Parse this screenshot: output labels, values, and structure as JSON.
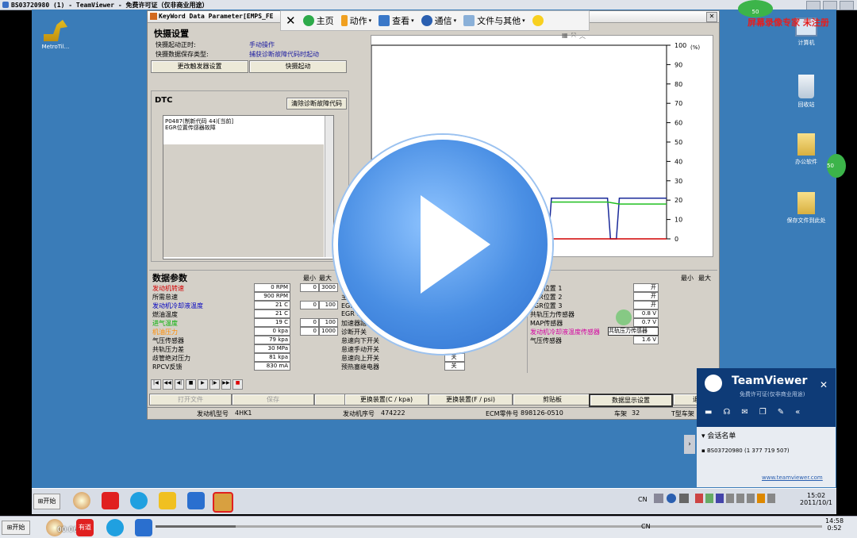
{
  "outer_window": {
    "title": "BS03720980 (1) - TeamViewer - 免费许可证（仅非商业用途）"
  },
  "desktop": {
    "icons": [
      {
        "label": "MetroTil..."
      },
      {
        "label": "计算机"
      },
      {
        "label": "回收站"
      },
      {
        "label": "办公软件"
      },
      {
        "label": "保存文件到此处"
      }
    ],
    "notice": "屏幕录像专家 未注册",
    "bubble1": "50",
    "bubble2": "50"
  },
  "teamviewer_toolbar": {
    "items": [
      "主页",
      "动作",
      "查看",
      "通信",
      "文件与其他"
    ]
  },
  "app": {
    "title": "KeyWord Data Parameter[EMPS_FE",
    "snapshot": {
      "title": "快摄设置",
      "start_label": "快摄起动正时:",
      "start_value": "手动操作",
      "save_label": "快摄数据保存类型:",
      "save_value": "捕获诊断故障代码时起动",
      "btn_trigger": "更改触发器设置",
      "btn_start": "快摄起动"
    },
    "dtc": {
      "title": "DTC",
      "btn_clear": "清除诊断故障代码",
      "line1": "P0487(制新代码 44)[当前]",
      "line2": "EGR位置传感器故障"
    },
    "data_params": {
      "title": "数据参数",
      "min_label": "最小",
      "max_label": "最大",
      "rows": [
        {
          "name": "发动机转速",
          "value": "0 RPM",
          "min": "0",
          "max": "3000",
          "color": "#d40000"
        },
        {
          "name": "所需怠速",
          "value": "900 RPM",
          "min": "",
          "max": "",
          "color": "#000000"
        },
        {
          "name": "发动机冷却液温度",
          "value": "21 C",
          "min": "0",
          "max": "100",
          "color": "#0000c0"
        },
        {
          "name": "燃油温度",
          "value": "21 C",
          "min": "",
          "max": "",
          "color": "#000000"
        },
        {
          "name": "进气温度",
          "value": "19 C",
          "min": "0",
          "max": "100",
          "color": "#00b000"
        },
        {
          "name": "机油压力",
          "value": "0 kpa",
          "min": "0",
          "max": "1000",
          "color": "#ff8c00"
        },
        {
          "name": "气压传感器",
          "value": "79 kpa",
          "min": "",
          "max": "",
          "color": "#000000"
        },
        {
          "name": "共轨压力差",
          "value": "30 MPa",
          "min": "",
          "max": "",
          "color": "#000000"
        },
        {
          "name": "歧管绝对压力",
          "value": "81 kpa",
          "min": "",
          "max": "",
          "color": "#000000"
        },
        {
          "name": "RPCV反馈",
          "value": "830 mA",
          "min": "",
          "max": "",
          "color": "#000000"
        }
      ],
      "mid_rows": [
        {
          "name": "系",
          "value": ""
        },
        {
          "name": "主缩",
          "value": ""
        },
        {
          "name": "EGR位",
          "value": ""
        },
        {
          "name": "EGR BLDC",
          "value": ""
        },
        {
          "name": "加速器踏板位",
          "value": ""
        },
        {
          "name": "诊断开关",
          "value": "关"
        },
        {
          "name": "怠速向下开关",
          "value": "关"
        },
        {
          "name": "怠速手动开关",
          "value": "关"
        },
        {
          "name": "怠速向上开关",
          "value": "关"
        },
        {
          "name": "预热塞继电器",
          "value": "关"
        }
      ],
      "right_rows": [
        {
          "name": "EGR位置 1",
          "value": "开",
          "color": "#000000"
        },
        {
          "name": "EGR位置 2",
          "value": "开",
          "color": "#000000"
        },
        {
          "name": "EGR位置 3",
          "value": "开",
          "color": "#000000"
        },
        {
          "name": "共轨压力传感器",
          "value": "0.8 V",
          "color": "#000000"
        },
        {
          "name": "MAP传感器",
          "value": "0.7 V",
          "color": "#000000"
        },
        {
          "name": "发动机冷却液温度传感器",
          "value": "共轨压力传感器",
          "color": "#d400a0"
        },
        {
          "name": "气压传感器",
          "value": "1.6 V",
          "color": "#000000"
        }
      ]
    },
    "bottom_buttons": [
      "打开文件",
      "保存",
      "另存为",
      "更换装置(C / kpa)",
      "更换装置(F / psi)",
      "剪贴板",
      "数据显示设置",
      "退"
    ],
    "status": {
      "engine_model_label": "发动机型号",
      "engine_model": "4HK1",
      "engine_serial_label": "发动机序号",
      "engine_serial": "474222",
      "ecm_label": "ECM零件号",
      "ecm": "898126-0510",
      "chassis_label": "车架",
      "chassis": "32",
      "t_label": "T型车架"
    }
  },
  "chart_data": {
    "type": "line",
    "y_ticks": [
      "100",
      "90",
      "80",
      "70",
      "60",
      "50",
      "40",
      "30",
      "20",
      "10",
      "0"
    ],
    "y_unit": "(%)",
    "ylim": [
      0,
      100
    ],
    "series": [
      {
        "color": "#1a2a9a",
        "points": [
          [
            0,
            0
          ],
          [
            60,
            0
          ],
          [
            61,
            21
          ],
          [
            80,
            21
          ],
          [
            81,
            0
          ],
          [
            83,
            0
          ],
          [
            84,
            21
          ],
          [
            100,
            21
          ]
        ]
      },
      {
        "color": "#20c020",
        "points": [
          [
            61,
            19
          ],
          [
            80,
            19
          ],
          [
            84,
            18
          ],
          [
            100,
            18
          ]
        ]
      },
      {
        "color": "#d00000",
        "points": [
          [
            0,
            0
          ],
          [
            100,
            0
          ]
        ]
      }
    ]
  },
  "teamviewer_panel": {
    "brand": "TeamViewer",
    "subtitle": "免费许可证(仅非商业用途)",
    "section": "会话名单",
    "session": "BS03720980 (1 377 719 507)",
    "link": "www.teamviewer.com"
  },
  "taskbar_remote": {
    "start": "开始",
    "lang": "CN",
    "time": "15:02",
    "date": "2011/10/1"
  },
  "taskbar_local": {
    "start": "开始",
    "lang": "CN",
    "time": "14:58",
    "date": "2011/10/1",
    "video_time": "00:06",
    "video_end": "0:52",
    "app_label": "有道"
  }
}
